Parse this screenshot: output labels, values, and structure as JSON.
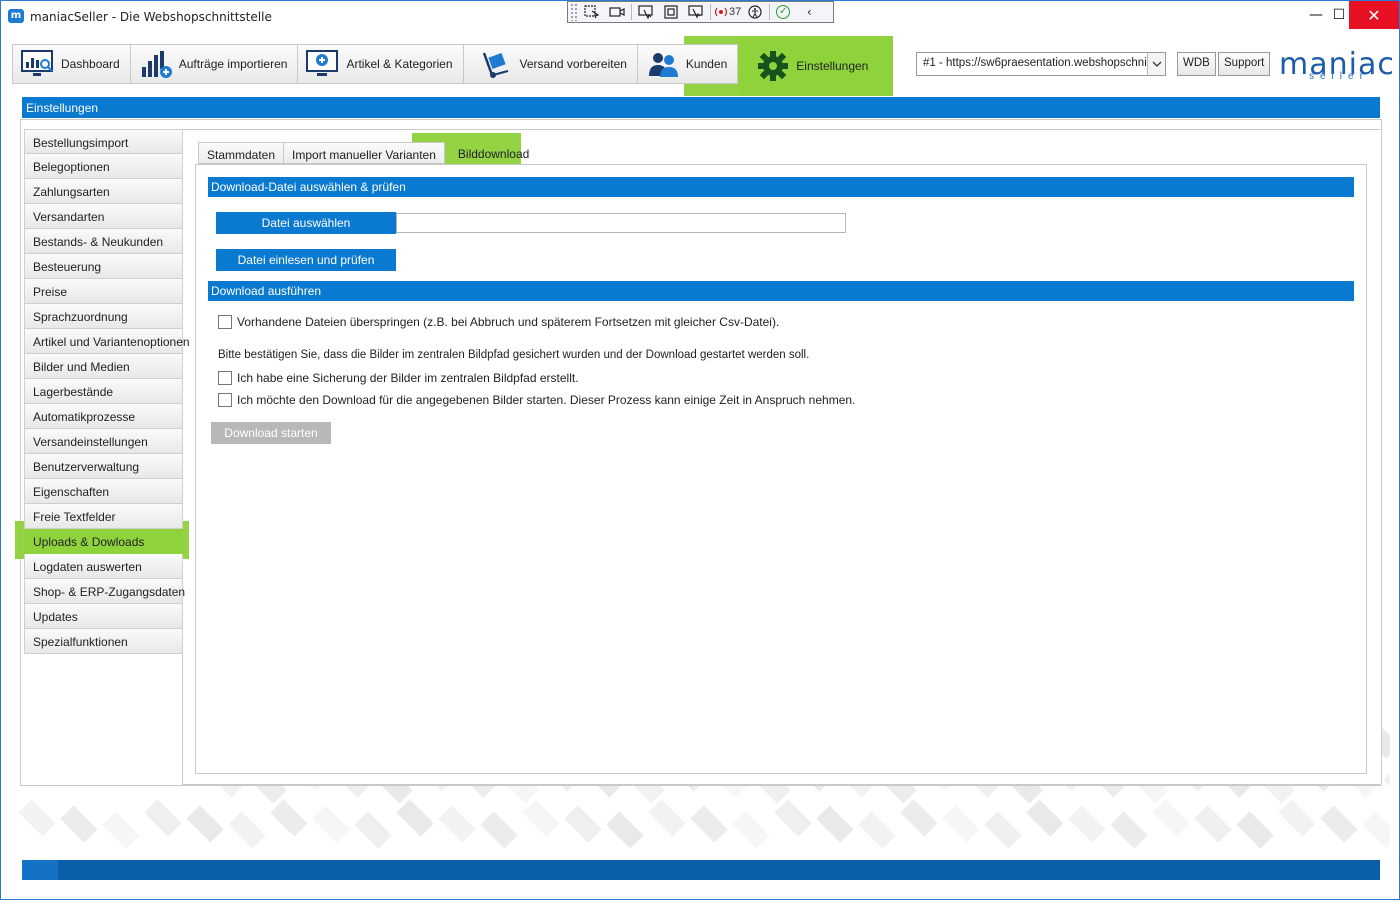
{
  "window": {
    "title": "maniacSeller - Die Webshopschnittstelle",
    "app_icon": "m",
    "controls": {
      "minimize": "—",
      "maximize": "☐",
      "close": "✕"
    }
  },
  "debug_toolbar": {
    "issue_count": "37",
    "icons": [
      "grip-icon",
      "select-element-icon",
      "video-icon",
      "pointer-icon",
      "frame-icon",
      "track-focus-icon",
      "live-region-icon",
      "accessibility-icon",
      "check-icon",
      "collapse-icon"
    ]
  },
  "nav": {
    "tabs": [
      {
        "label": "Dashboard",
        "icon": "dashboard-icon"
      },
      {
        "label": "Aufträge importieren",
        "icon": "orders-icon"
      },
      {
        "label": "Artikel & Kategorien",
        "icon": "articles-icon"
      },
      {
        "label": "Versand vorbereiten",
        "icon": "shipping-icon"
      },
      {
        "label": "Kunden",
        "icon": "customers-icon"
      },
      {
        "label": "Einstellungen",
        "icon": "gear-icon",
        "active": true
      }
    ],
    "shop_select": "#1 - https://sw6praesentation.webshopschni...",
    "wdb_label": "WDB",
    "support_label": "Support",
    "logo_main": "maniac",
    "logo_sub": "seller"
  },
  "section_title": "Einstellungen",
  "sidebar": {
    "items": [
      {
        "label": "Bestellungsimport"
      },
      {
        "label": "Belegoptionen"
      },
      {
        "label": "Zahlungsarten"
      },
      {
        "label": "Versandarten"
      },
      {
        "label": "Bestands- & Neukunden"
      },
      {
        "label": "Besteuerung"
      },
      {
        "label": "Preise"
      },
      {
        "label": "Sprachzuordnung"
      },
      {
        "label": "Artikel und Variantenoptionen"
      },
      {
        "label": "Bilder und Medien"
      },
      {
        "label": "Lagerbestände"
      },
      {
        "label": "Automatikprozesse"
      },
      {
        "label": "Versandeinstellungen"
      },
      {
        "label": "Benutzerverwaltung"
      },
      {
        "label": "Eigenschaften"
      },
      {
        "label": "Freie Textfelder"
      },
      {
        "label": "Uploads & Dowloads",
        "active": true
      },
      {
        "label": "Logdaten auswerten"
      },
      {
        "label": "Shop- & ERP-Zugangsdaten"
      },
      {
        "label": "Updates"
      },
      {
        "label": "Spezialfunktionen"
      }
    ]
  },
  "subtabs": [
    {
      "label": "Stammdaten"
    },
    {
      "label": "Import manueller Varianten"
    },
    {
      "label": "Bilddownload",
      "active": true
    }
  ],
  "download_file": {
    "heading": "Download-Datei auswählen & prüfen",
    "choose_button": "Datei auswählen",
    "file_path": "",
    "check_button": "Datei einlesen und prüfen"
  },
  "download_run": {
    "heading": "Download ausführen",
    "skip_existing": {
      "label": "Vorhandene Dateien überspringen (z.B. bei Abbruch und späterem Fortsetzen mit gleicher Csv-Datei).",
      "checked": false
    },
    "confirm_text": "Bitte bestätigen Sie, dass die Bilder im zentralen Bildpfad gesichert wurden und der Download gestartet werden soll.",
    "confirm_backup": {
      "label": "Ich habe eine Sicherung der Bilder im zentralen Bildpfad erstellt.",
      "checked": false
    },
    "confirm_start": {
      "label": "Ich möchte den Download für die angegebenen Bilder starten. Dieser Prozess kann einige Zeit in Anspruch nehmen.",
      "checked": false
    },
    "start_button": "Download starten"
  },
  "colors": {
    "accent_blue": "#0a79d0",
    "highlight_green": "#8fd33c",
    "disabled_gray": "#b8b8b8"
  }
}
